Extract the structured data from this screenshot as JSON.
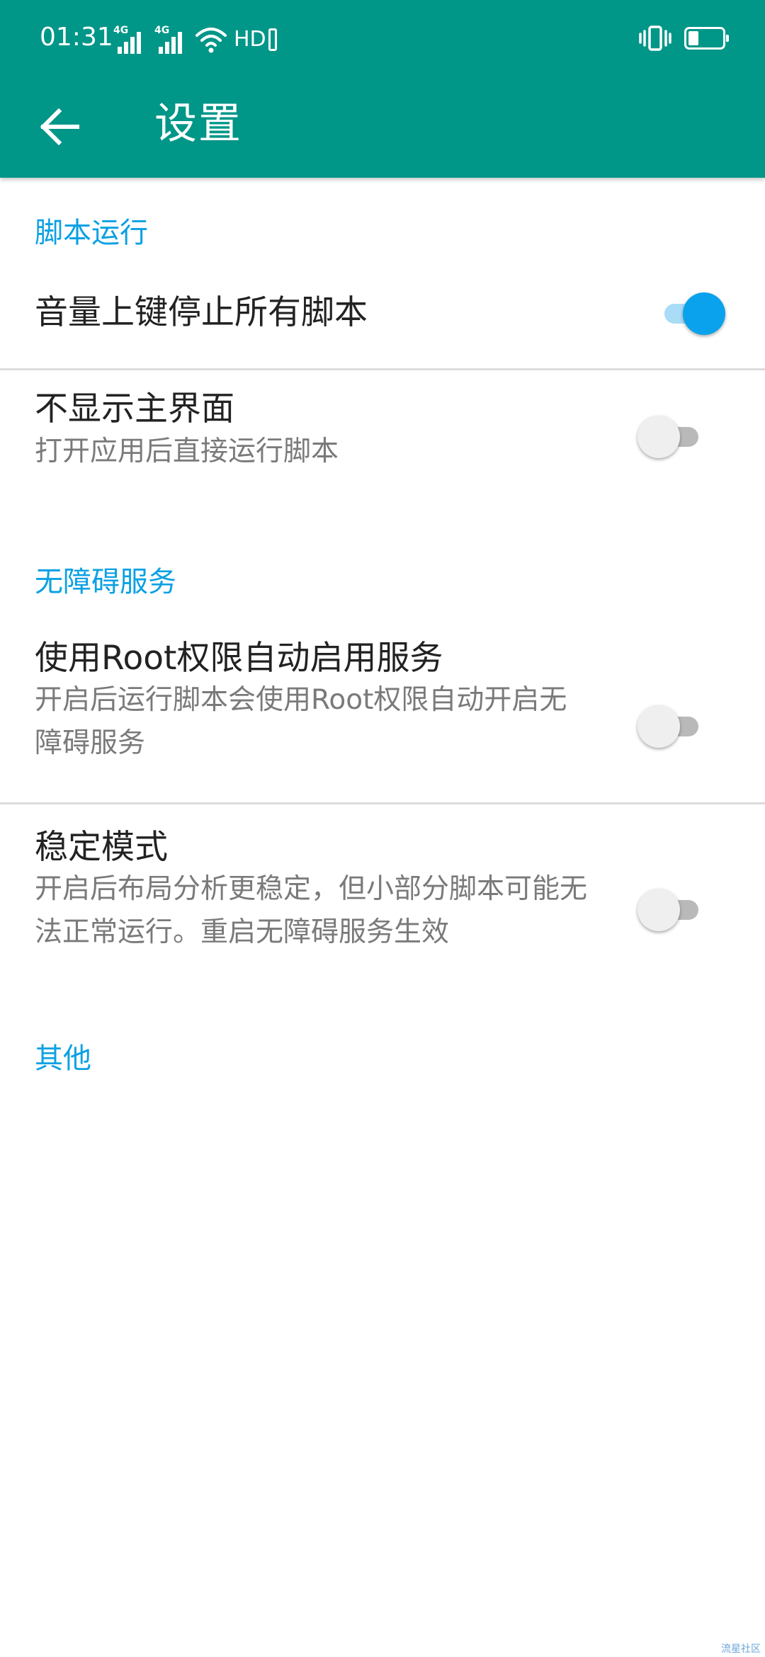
{
  "status_bar": {
    "time": "01:31",
    "network_1": "4G",
    "network_2": "4G",
    "hd_label": "HD",
    "battery_level": 0.3,
    "icons": [
      "signal-icon",
      "signal-icon",
      "wifi-icon",
      "hd-voice-icon",
      "vibrate-icon",
      "battery-icon"
    ]
  },
  "app_bar": {
    "title": "设置",
    "back_icon": "arrow-back-icon",
    "color": "#009688"
  },
  "accent_color": "#0ba1e3",
  "sections": [
    {
      "header": "脚本运行",
      "items": [
        {
          "title": "音量上键停止所有脚本",
          "summary": "",
          "enabled": true
        },
        {
          "title": "不显示主界面",
          "summary": "打开应用后直接运行脚本",
          "enabled": false
        }
      ]
    },
    {
      "header": "无障碍服务",
      "items": [
        {
          "title": "使用Root权限自动启用服务",
          "summary": "开启后运行脚本会使用Root权限自动开启无障碍服务",
          "enabled": false
        },
        {
          "title": "稳定模式",
          "summary": "开启后布局分析更稳定，但小部分脚本可能无法正常运行。重启无障碍服务生效",
          "enabled": false
        }
      ]
    },
    {
      "header": "其他",
      "items": []
    }
  ],
  "watermark": "流星社区"
}
